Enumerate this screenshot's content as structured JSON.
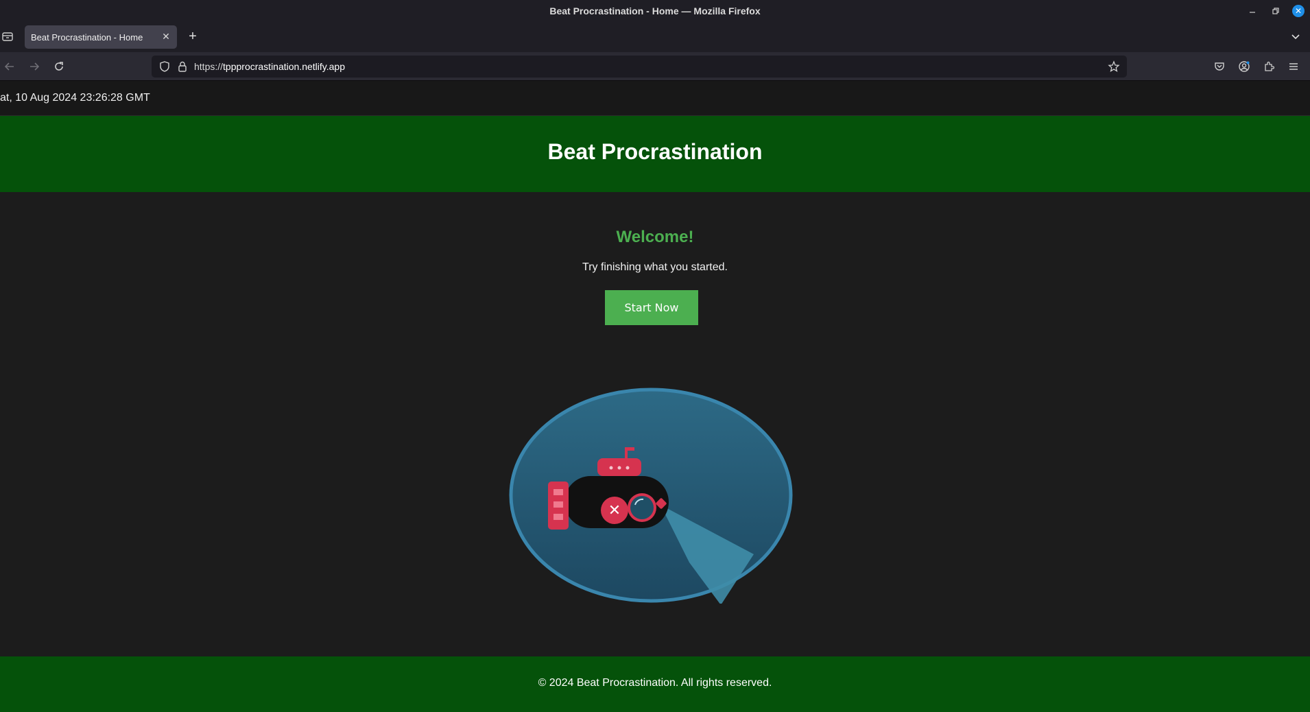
{
  "window": {
    "title": "Beat Procrastination - Home — Mozilla Firefox"
  },
  "browser": {
    "tabs": [
      {
        "title": "Beat Procrastination - Home",
        "active": true
      }
    ],
    "url_scheme": "https://",
    "url_host": "tppprocrastination.netlify.app",
    "icons": {
      "back": "back-arrow-icon",
      "forward": "forward-arrow-icon",
      "reload": "reload-icon",
      "pocket": "pocket-icon",
      "account": "account-icon",
      "extensions": "extensions-icon",
      "menu": "hamburger-menu-icon"
    }
  },
  "page": {
    "date_text": "at, 10 Aug 2024 23:26:28 GMT",
    "header_title": "Beat Procrastination",
    "welcome": "Welcome!",
    "tagline": "Try finishing what you started.",
    "cta_label": "Start Now",
    "footer_text": "© 2024 Beat Procrastination. All rights reserved."
  },
  "colors": {
    "header_green": "#05520a",
    "accent_green": "#4caf50",
    "page_bg": "#1c1c1c",
    "illustration_blue": "#2a5f7a",
    "submarine_red": "#d6334f"
  }
}
